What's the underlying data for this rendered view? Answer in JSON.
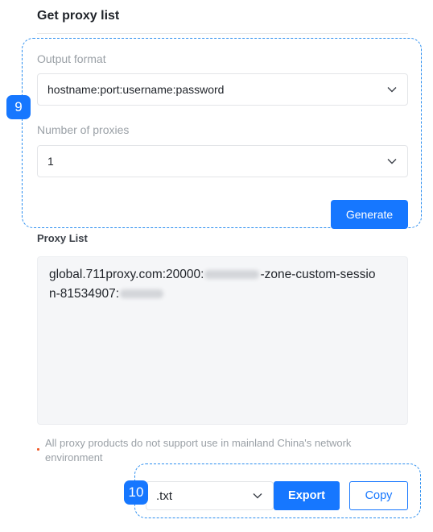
{
  "header": {
    "title": "Get proxy list"
  },
  "callouts": {
    "generate_step": "9",
    "export_step": "10"
  },
  "form": {
    "format_label": "Output format",
    "format_value": "hostname:port:username:password",
    "count_label": "Number of proxies",
    "count_value": "1",
    "generate_label": "Generate"
  },
  "result": {
    "label": "Proxy List",
    "line1_prefix": "global.711proxy.com:20000:",
    "line1_suffix": "-zone-custom-sessio",
    "line2_prefix": "n-81534907:"
  },
  "notice": {
    "text": "All proxy products do not support use in mainland China's network environment"
  },
  "export": {
    "file_type": ".txt",
    "export_label": "Export",
    "copy_label": "Copy"
  },
  "colors": {
    "accent": "#1677ff",
    "callout_outline": "#2b8ef0",
    "notice_dot": "#f05a28"
  }
}
